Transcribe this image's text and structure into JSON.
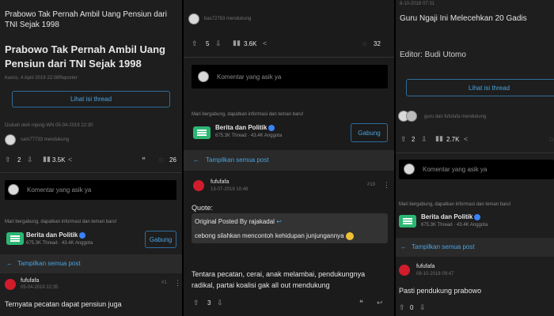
{
  "panel1": {
    "top_title": "Prabowo Tak Pernah Ambil Uang Pensiun dari TNI Sejak 1998",
    "headline": "Prabowo Tak Pernah Ambil Uang Pensiun dari TNI Sejak 1998",
    "byline": "Kamis, 4 April 2019 22:08Reporter",
    "thread_button": "Lihat isi thread",
    "edited_note": "Diubah oleh rojeng-WN 05-04-2019 22:30",
    "reposter": "sam77733 mendukung",
    "upvotes": "2",
    "views": "3.5K",
    "comments": "26",
    "comment_placeholder": "Komentar yang asik ya",
    "join_prompt": "Mari bergabung, dapatkan informasi dan teman baru!",
    "community_name": "Berita dan Politik",
    "community_stats": "675.3K Thread · 43.4K Anggota",
    "join_button": "Gabung",
    "show_all": "Tampilkan semua post",
    "commenter": "fufufafa",
    "comment_time": "05-04-2019 22:35",
    "comment_number": "#1",
    "comment_text": "Ternyata pecatan dapat pensiun juga"
  },
  "panel2": {
    "reposter": "bas72783 mendukung",
    "upvotes": "5",
    "views": "3.6K",
    "comments": "32",
    "comment_placeholder": "Komentar yang asik ya",
    "join_prompt": "Mari bergabung, dapatkan informasi dan teman baru!",
    "community_name": "Berita dan Politik",
    "community_stats": "675.3K Thread · 43.4K Anggota",
    "join_button": "Gabung",
    "show_all": "Tampilkan semua post",
    "commenter": "fufufafa",
    "comment_time": "13-07-2019 10:48",
    "comment_number": "#19",
    "quote_label": "Quote:",
    "quote_source": "Original Posted By rajakadal",
    "quote_text": "cebong silahkan mencontoh kehidupan junjungannya",
    "body_text": "Tentara pecatan, cerai, anak melambai, pendukungnya radikal, partai koalisi gak all out mendukung",
    "reply_upvotes": "3"
  },
  "panel3": {
    "top_meta": "8-10-2018 07:31",
    "headline": "Guru Ngaji Ini Melecehkan 20 Gadis",
    "editor": "Editor: Budi Utomo",
    "thread_button": "Lihat isi thread",
    "reposter": "guru dan fufufafa mendukung",
    "upvotes": "2",
    "views": "2.7K",
    "comment_placeholder": "Komentar yang asik ya",
    "join_prompt": "Mari bergabung, dapatkan informasi dan teman baru!",
    "community_name": "Berita dan Politik",
    "community_stats": "675.3K Thread · 43.4K Anggota",
    "show_all": "Tampilkan semua post",
    "commenter": "fufufafa",
    "comment_time": "08-10-2018 09:47",
    "comment_text": "Pasti pendukung prabowo",
    "reply_upvotes": "0"
  },
  "colors": {
    "accent_blue": "#4aa3df",
    "community_green": "#2bb673",
    "avatar_red": "#d11c2c",
    "panel_bg": "#1e1e1e"
  }
}
